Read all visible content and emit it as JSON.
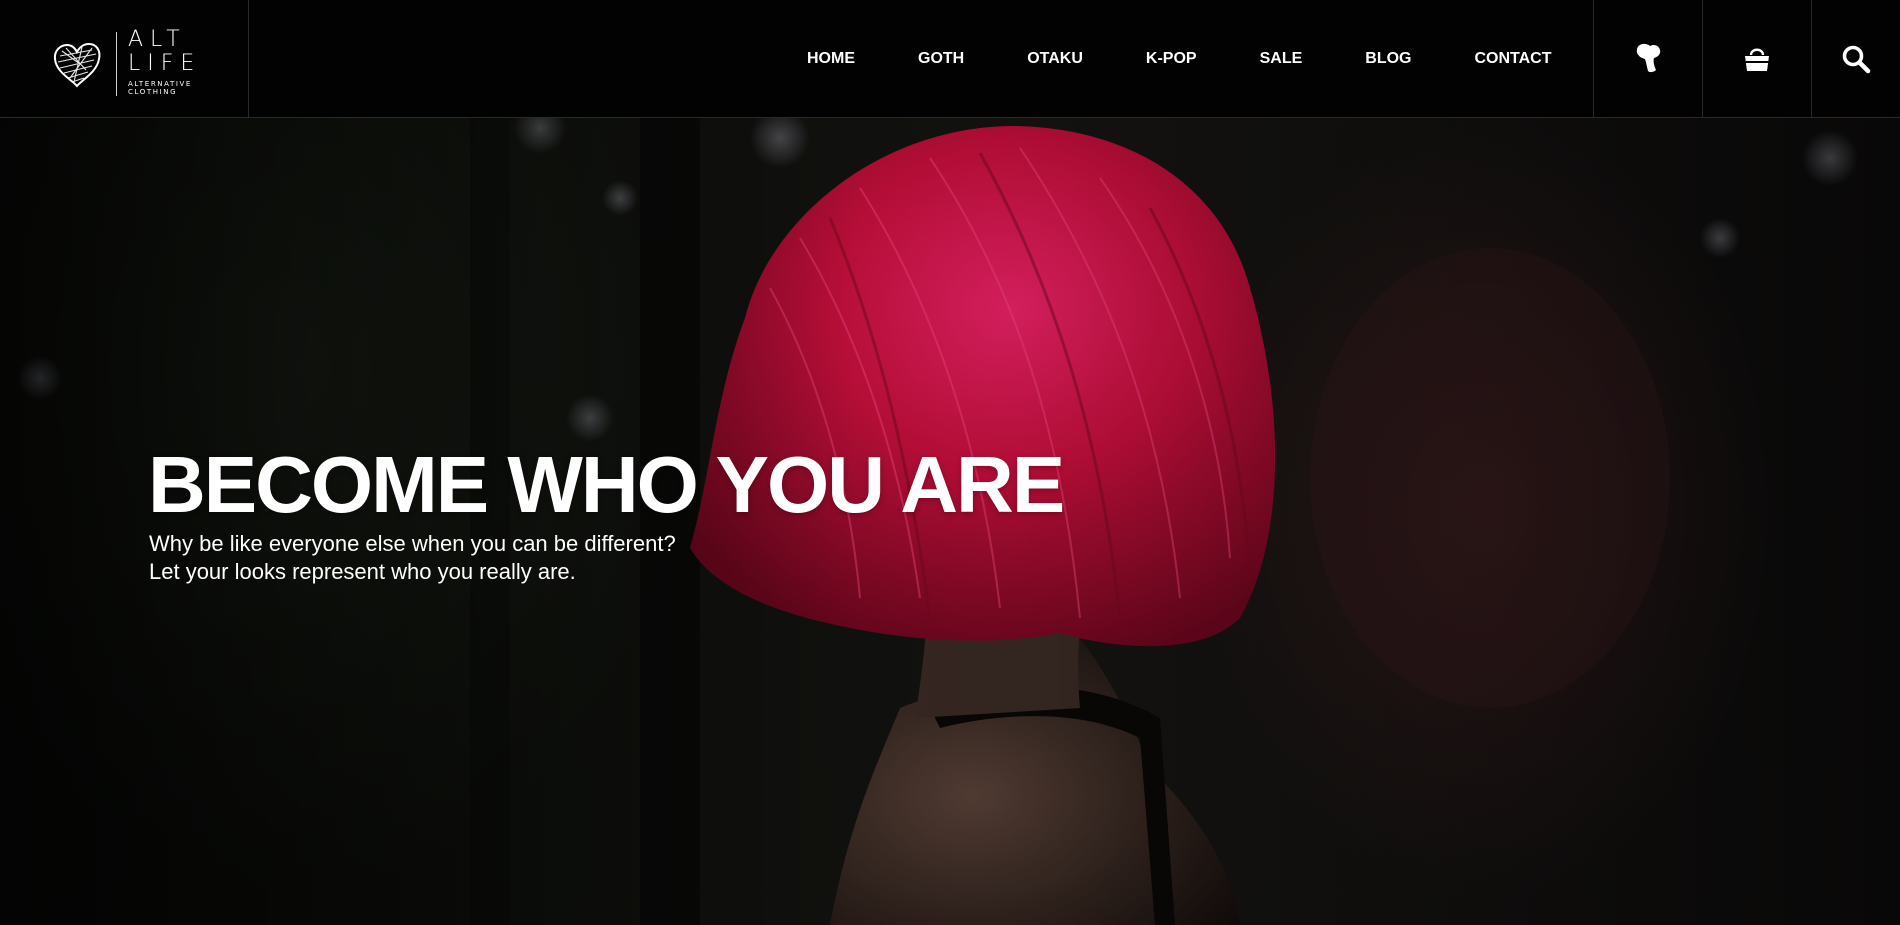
{
  "brand": {
    "line1": "ALT",
    "line2": "LIFE",
    "tagline1": "ALTERNATIVE",
    "tagline2": "CLOTHING"
  },
  "nav": {
    "items": [
      {
        "label": "HOME"
      },
      {
        "label": "GOTH"
      },
      {
        "label": "OTAKU"
      },
      {
        "label": "K-POP"
      },
      {
        "label": "SALE"
      },
      {
        "label": "BLOG"
      },
      {
        "label": "CONTACT"
      }
    ]
  },
  "header_icons": [
    "pin-icon",
    "shopping-bag-icon",
    "search-icon"
  ],
  "hero": {
    "title": "BECOME WHO YOU ARE",
    "subtitle_line1": "Why be like everyone else when you can be different?",
    "subtitle_line2": "Let your looks represent who you really are."
  },
  "colors": {
    "header_bg": "#020202",
    "hair_red": "#d0123f",
    "text": "#ffffff"
  }
}
